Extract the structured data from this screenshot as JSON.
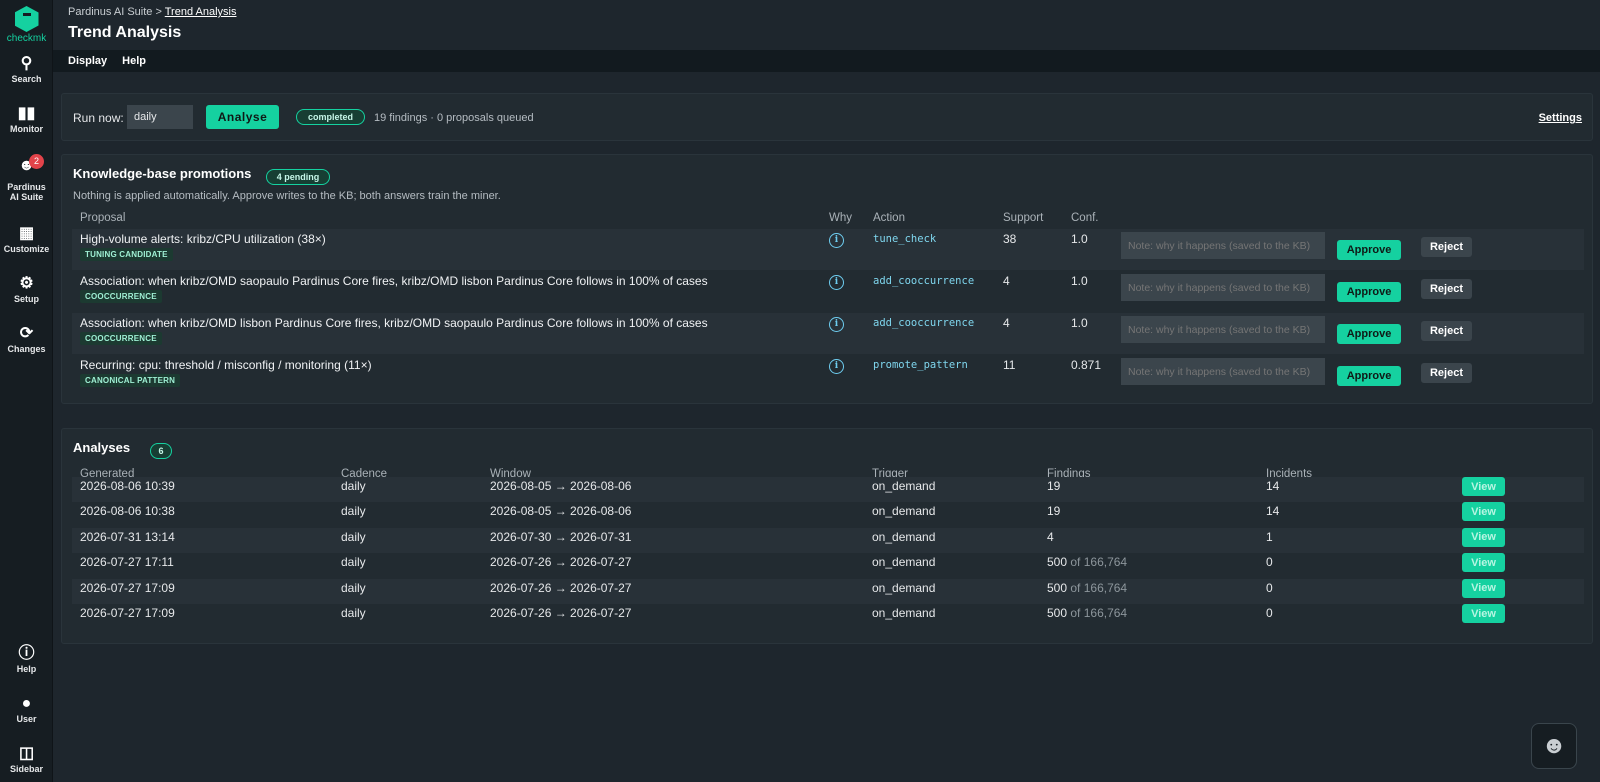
{
  "brand": {
    "name": "checkmk"
  },
  "nav": {
    "search": "Search",
    "monitor": "Monitor",
    "pardinus": "Pardinus\nAI Suite",
    "pardinus_l1": "Pardinus",
    "pardinus_l2": "AI Suite",
    "pardinus_badge": "2",
    "customize": "Customize",
    "setup": "Setup",
    "changes": "Changes",
    "help": "Help",
    "user": "User",
    "sidebar": "Sidebar"
  },
  "breadcrumb": {
    "root": "Pardinus AI Suite",
    "sep": ">",
    "current": "Trend Analysis"
  },
  "page": {
    "title": "Trend Analysis"
  },
  "menu": {
    "display": "Display",
    "help": "Help"
  },
  "run": {
    "label": "Run now:",
    "cadence": "daily",
    "button": "Analyse",
    "status": "completed",
    "info": "19 findings · 0 proposals queued",
    "settings": "Settings"
  },
  "kb": {
    "title": "Knowledge-base promotions",
    "pending": "4 pending",
    "note": "Nothing is applied automatically. Approve writes to the KB; both answers train the miner.",
    "headers": {
      "proposal": "Proposal",
      "why": "Why",
      "action": "Action",
      "support": "Support",
      "conf": "Conf."
    },
    "note_placeholder": "Note: why it happens (saved to the KB)",
    "approve": "Approve",
    "reject": "Reject",
    "rows": [
      {
        "text": "High-volume alerts: kribz/CPU utilization (38×)",
        "tag": "TUNING CANDIDATE",
        "action": "tune_check",
        "support": "38",
        "conf": "1.0"
      },
      {
        "text": "Association: when kribz/OMD saopaulo Pardinus Core fires, kribz/OMD lisbon Pardinus Core follows in 100% of cases",
        "tag": "COOCCURRENCE",
        "action": "add_cooccurrence",
        "support": "4",
        "conf": "1.0"
      },
      {
        "text": "Association: when kribz/OMD lisbon Pardinus Core fires, kribz/OMD saopaulo Pardinus Core follows in 100% of cases",
        "tag": "COOCCURRENCE",
        "action": "add_cooccurrence",
        "support": "4",
        "conf": "1.0"
      },
      {
        "text": "Recurring: cpu: threshold / misconfig / monitoring (11×)",
        "tag": "CANONICAL PATTERN",
        "action": "promote_pattern",
        "support": "11",
        "conf": "0.871"
      }
    ]
  },
  "analyses": {
    "title": "Analyses",
    "count": "6",
    "headers": {
      "generated": "Generated",
      "cadence": "Cadence",
      "window": "Window",
      "trigger": "Trigger",
      "findings": "Findings",
      "incidents": "Incidents"
    },
    "view": "View",
    "rows": [
      {
        "generated": "2026-08-06 10:39",
        "cadence": "daily",
        "window": "2026-08-05 → 2026-08-06",
        "trigger": "on_demand",
        "findings": "19",
        "of": "",
        "incidents": "14"
      },
      {
        "generated": "2026-08-06 10:38",
        "cadence": "daily",
        "window": "2026-08-05 → 2026-08-06",
        "trigger": "on_demand",
        "findings": "19",
        "of": "",
        "incidents": "14"
      },
      {
        "generated": "2026-07-31 13:14",
        "cadence": "daily",
        "window": "2026-07-30 → 2026-07-31",
        "trigger": "on_demand",
        "findings": "4",
        "of": "",
        "incidents": "1"
      },
      {
        "generated": "2026-07-27 17:11",
        "cadence": "daily",
        "window": "2026-07-26 → 2026-07-27",
        "trigger": "on_demand",
        "findings": "500",
        "of": "of 166,764",
        "incidents": "0"
      },
      {
        "generated": "2026-07-27 17:09",
        "cadence": "daily",
        "window": "2026-07-26 → 2026-07-27",
        "trigger": "on_demand",
        "findings": "500",
        "of": "of 166,764",
        "incidents": "0"
      },
      {
        "generated": "2026-07-27 17:09",
        "cadence": "daily",
        "window": "2026-07-26 → 2026-07-27",
        "trigger": "on_demand",
        "findings": "500",
        "of": "of 166,764",
        "incidents": "0"
      }
    ]
  },
  "icons": {
    "search": "search-icon",
    "monitor": "bar-chart-icon",
    "customize": "grid-icon",
    "setup": "gear-icon",
    "changes": "changes-icon",
    "help": "info-icon",
    "user": "user-icon",
    "sidebar": "sidebar-icon",
    "assistant": "lynx-icon"
  },
  "colors": {
    "accent": "#15d1a0",
    "badge": "#e2434a",
    "background": "#1e262d"
  }
}
